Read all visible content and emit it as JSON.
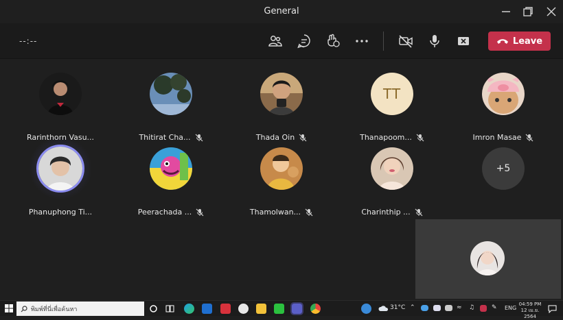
{
  "window": {
    "title": "General"
  },
  "toolbar": {
    "timer": "--:--",
    "leave_label": "Leave"
  },
  "participants": [
    {
      "name": "Rarinthorn Vasu...",
      "muted": false
    },
    {
      "name": "Thitirat Cha...",
      "muted": true
    },
    {
      "name": "Thada Oin",
      "muted": true
    },
    {
      "name": "Thanapoom...",
      "muted": true,
      "initials": "TT"
    },
    {
      "name": "Imron Masae",
      "muted": true
    },
    {
      "name": "Phanuphong Ti...",
      "muted": false,
      "speaking": true
    },
    {
      "name": "Peerachada ...",
      "muted": true
    },
    {
      "name": "Thamolwan...",
      "muted": true
    },
    {
      "name": "Charinthip ...",
      "muted": true
    }
  ],
  "overflow": {
    "label": "+5"
  },
  "taskbar": {
    "search_placeholder": "พิมพ์ที่นี่เพื่อค้นหา",
    "weather": "31°C",
    "language": "ENG",
    "time": "04:59 PM",
    "date": "12 เม.ย. 2564"
  },
  "colors": {
    "leave": "#c4314b",
    "speaking_ring": "#8b8cf0",
    "background": "#1f1f1f"
  }
}
